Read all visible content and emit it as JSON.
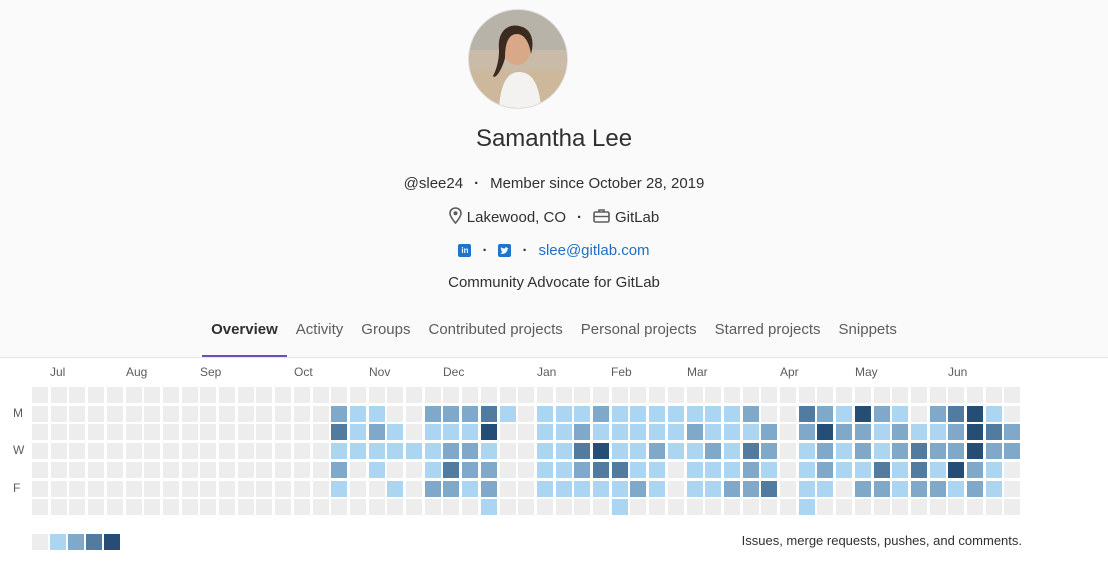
{
  "profile": {
    "name": "Samantha Lee",
    "username": "@slee24",
    "member_since": "Member since October 28, 2019",
    "location": "Lakewood, CO",
    "organization": "GitLab",
    "email": "slee@gitlab.com",
    "bio": "Community Advocate for GitLab",
    "social_icons": [
      "linkedin-icon",
      "twitter-icon"
    ]
  },
  "tabs": [
    {
      "label": "Overview",
      "active": true
    },
    {
      "label": "Activity",
      "active": false
    },
    {
      "label": "Groups",
      "active": false
    },
    {
      "label": "Contributed projects",
      "active": false
    },
    {
      "label": "Personal projects",
      "active": false
    },
    {
      "label": "Starred projects",
      "active": false
    },
    {
      "label": "Snippets",
      "active": false
    }
  ],
  "calendar": {
    "months": [
      "Jul",
      "Aug",
      "Sep",
      "Oct",
      "Nov",
      "Dec",
      "Jan",
      "Feb",
      "Mar",
      "Apr",
      "May",
      "Jun"
    ],
    "day_labels": [
      "M",
      "W",
      "F"
    ],
    "level_colors": [
      "#ededed",
      "#acd5f2",
      "#7fa8c9",
      "#527ba0",
      "#254e77"
    ],
    "legend_text": "Issues, merge requests, pushes, and comments.",
    "weeks": [
      [
        0,
        0,
        0,
        0,
        0,
        0,
        0
      ],
      [
        0,
        0,
        0,
        0,
        0,
        0,
        0
      ],
      [
        0,
        0,
        0,
        0,
        0,
        0,
        0
      ],
      [
        0,
        0,
        0,
        0,
        0,
        0,
        0
      ],
      [
        0,
        0,
        0,
        0,
        0,
        0,
        0
      ],
      [
        0,
        0,
        0,
        0,
        0,
        0,
        0
      ],
      [
        0,
        0,
        0,
        0,
        0,
        0,
        0
      ],
      [
        0,
        0,
        0,
        0,
        0,
        0,
        0
      ],
      [
        0,
        0,
        0,
        0,
        0,
        0,
        0
      ],
      [
        0,
        0,
        0,
        0,
        0,
        0,
        0
      ],
      [
        0,
        0,
        0,
        0,
        0,
        0,
        0
      ],
      [
        0,
        0,
        0,
        0,
        0,
        0,
        0
      ],
      [
        0,
        0,
        0,
        0,
        0,
        0,
        0
      ],
      [
        0,
        0,
        0,
        0,
        0,
        0,
        0
      ],
      [
        0,
        0,
        0,
        0,
        0,
        0,
        0
      ],
      [
        0,
        0,
        0,
        0,
        0,
        0,
        0
      ],
      [
        0,
        2,
        3,
        1,
        2,
        1,
        0
      ],
      [
        0,
        1,
        1,
        1,
        0,
        0,
        0
      ],
      [
        0,
        1,
        2,
        1,
        1,
        0,
        0
      ],
      [
        0,
        0,
        1,
        1,
        0,
        1,
        0
      ],
      [
        0,
        0,
        0,
        1,
        0,
        0,
        0
      ],
      [
        0,
        2,
        1,
        1,
        1,
        2,
        0
      ],
      [
        0,
        2,
        1,
        2,
        3,
        2,
        0
      ],
      [
        0,
        2,
        1,
        2,
        2,
        1,
        0
      ],
      [
        0,
        3,
        4,
        1,
        2,
        2,
        1
      ],
      [
        0,
        1,
        0,
        0,
        0,
        0,
        0
      ],
      [
        0,
        0,
        0,
        0,
        0,
        0,
        0
      ],
      [
        0,
        1,
        1,
        1,
        1,
        1,
        0
      ],
      [
        0,
        1,
        1,
        1,
        1,
        1,
        0
      ],
      [
        0,
        1,
        2,
        3,
        2,
        1,
        0
      ],
      [
        0,
        2,
        1,
        4,
        3,
        1,
        0
      ],
      [
        0,
        1,
        1,
        1,
        3,
        1,
        1
      ],
      [
        0,
        1,
        1,
        1,
        1,
        2,
        0
      ],
      [
        0,
        1,
        1,
        2,
        1,
        1,
        0
      ],
      [
        0,
        1,
        1,
        1,
        0,
        0,
        0
      ],
      [
        0,
        1,
        2,
        1,
        1,
        1,
        0
      ],
      [
        0,
        1,
        1,
        2,
        1,
        1,
        0
      ],
      [
        0,
        1,
        1,
        1,
        1,
        2,
        0
      ],
      [
        0,
        2,
        1,
        3,
        2,
        2,
        0
      ],
      [
        0,
        0,
        2,
        2,
        1,
        3,
        0
      ],
      [
        0,
        0,
        0,
        0,
        0,
        0,
        0
      ],
      [
        0,
        3,
        2,
        1,
        1,
        1,
        1
      ],
      [
        0,
        2,
        4,
        2,
        2,
        1,
        0
      ],
      [
        0,
        1,
        2,
        1,
        1,
        0,
        0
      ],
      [
        0,
        4,
        2,
        2,
        1,
        2,
        0
      ],
      [
        0,
        2,
        1,
        1,
        3,
        2,
        0
      ],
      [
        0,
        1,
        2,
        2,
        1,
        1,
        0
      ],
      [
        0,
        0,
        1,
        3,
        3,
        2,
        0
      ],
      [
        0,
        2,
        1,
        2,
        1,
        2,
        0
      ],
      [
        0,
        3,
        2,
        2,
        4,
        1,
        0
      ],
      [
        0,
        4,
        4,
        4,
        2,
        2,
        0
      ],
      [
        0,
        1,
        3,
        2,
        1,
        1,
        0
      ],
      [
        0,
        0,
        2,
        2,
        0,
        0,
        0
      ]
    ]
  }
}
